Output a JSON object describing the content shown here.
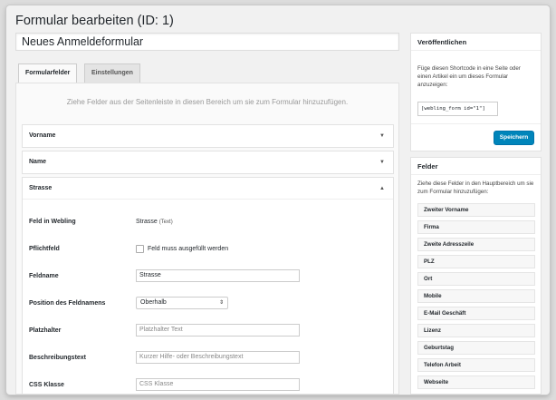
{
  "page": {
    "title": "Formular bearbeiten (ID: 1)",
    "form_title": "Neues Anmeldeformular"
  },
  "tabs": [
    {
      "label": "Formularfelder",
      "active": true
    },
    {
      "label": "Einstellungen",
      "active": false
    }
  ],
  "main": {
    "hint": "Ziehe Felder aus der Seitenleiste in diesen Bereich um sie zum Formular hinzuzufügen.",
    "fields": [
      {
        "label": "Vorname",
        "arrow": "▼"
      },
      {
        "label": "Name",
        "arrow": "▼"
      },
      {
        "label": "Strasse",
        "arrow": "▲"
      }
    ],
    "details": {
      "webling_label": "Feld in Webling",
      "webling_value": "Strasse",
      "webling_type": "(Text)",
      "required_label": "Pflichtfeld",
      "required_checkbox_label": "Feld muss ausgefüllt werden",
      "fieldname_label": "Feldname",
      "fieldname_value": "Strasse",
      "position_label": "Position des Feldnamens",
      "position_value": "Oberhalb",
      "placeholder_label": "Platzhalter",
      "placeholder_value": "Platzhalter Text",
      "description_label": "Beschreibungstext",
      "description_value": "Kurzer Hilfe- oder Beschreibungstext",
      "css_label": "CSS Klasse",
      "css_value": "CSS Klasse"
    }
  },
  "publish": {
    "title": "Veröffentlichen",
    "text": "Füge diesen Shortcode in eine Seite oder einen Artikel ein um dieses Formular anzuzeigen:",
    "shortcode": "[webling_form id=\"1\"]",
    "save_label": "Speichern"
  },
  "palette": {
    "title": "Felder",
    "text": "Ziehe diese Felder in den Hauptbereich um sie zum Formular hinzuzufügen:",
    "items": [
      "Zweiter Vorname",
      "Firma",
      "Zweite Adresszeile",
      "PLZ",
      "Ort",
      "Mobile",
      "E-Mail Geschäft",
      "Lizenz",
      "Geburtstag",
      "Telefon Arbeit",
      "Webseite"
    ]
  },
  "colors": {
    "primary_button": "#0085ba",
    "page_bg": "#f1f1f1"
  },
  "icons": {
    "collapsed": "chevron-down-icon",
    "expanded": "chevron-up-icon",
    "select": "select-arrows-icon"
  }
}
